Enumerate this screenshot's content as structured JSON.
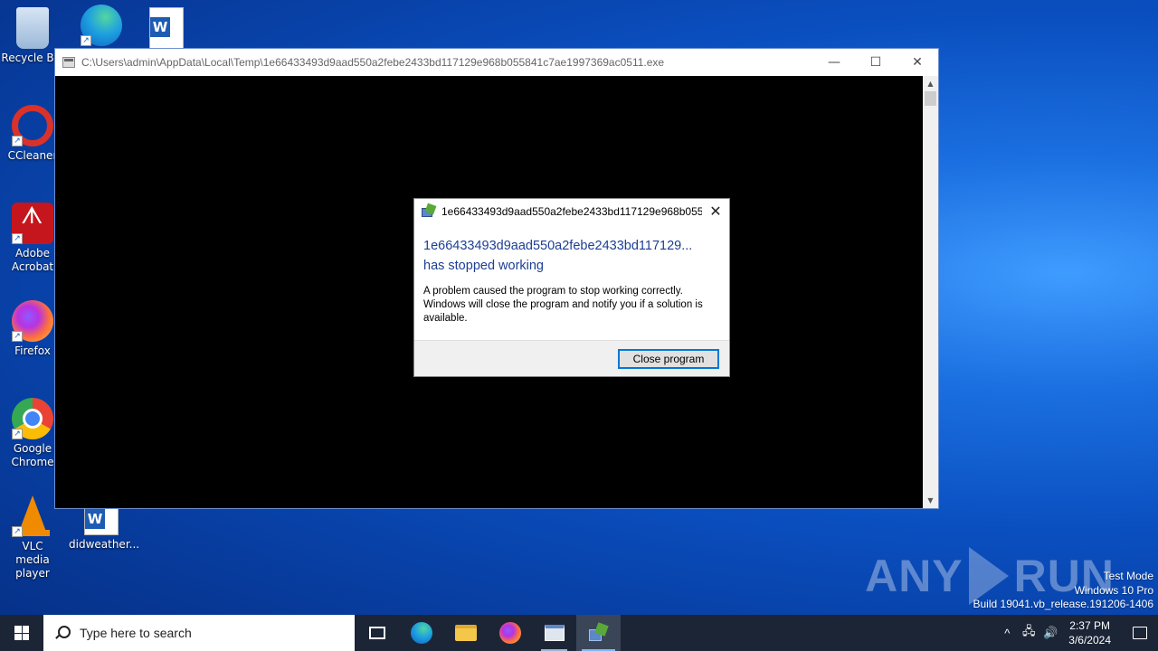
{
  "desktop": {
    "icons": [
      {
        "label": "Recycle Bin"
      },
      {
        "label": ""
      },
      {
        "label": ""
      },
      {
        "label": "CCleaner"
      },
      {
        "label": "Adobe Acrobat"
      },
      {
        "label": "Firefox"
      },
      {
        "label": "Google Chrome"
      },
      {
        "label": "VLC media player"
      },
      {
        "label": "didweather..."
      }
    ]
  },
  "console_window": {
    "title": "C:\\Users\\admin\\AppData\\Local\\Temp\\1e66433493d9aad550a2febe2433bd117129e968b055841c7ae1997369ac0511.exe",
    "minimize": "—",
    "maximize": "☐",
    "close": "✕"
  },
  "dialog": {
    "title": "1e66433493d9aad550a2febe2433bd117129e968b0558...",
    "close": "✕",
    "heading_line1": "1e66433493d9aad550a2febe2433bd117129...",
    "heading_line2": "has stopped working",
    "message": "A problem caused the program to stop working correctly. Windows will close the program and notify you if a solution is available.",
    "button_label": "Close program"
  },
  "watermark": {
    "left": "ANY",
    "right": "RUN"
  },
  "system_info": {
    "line1": "Test Mode",
    "line2": "Windows 10 Pro",
    "line3": "Build 19041.vb_release.191206-1406"
  },
  "taskbar": {
    "search_placeholder": "Type here to search",
    "time": "2:37 PM",
    "date": "3/6/2024",
    "tray_chevron": "^"
  },
  "colors": {
    "accent": "#0078d7",
    "dialog_heading": "#1c3f94",
    "taskbar": "#1c2536"
  }
}
